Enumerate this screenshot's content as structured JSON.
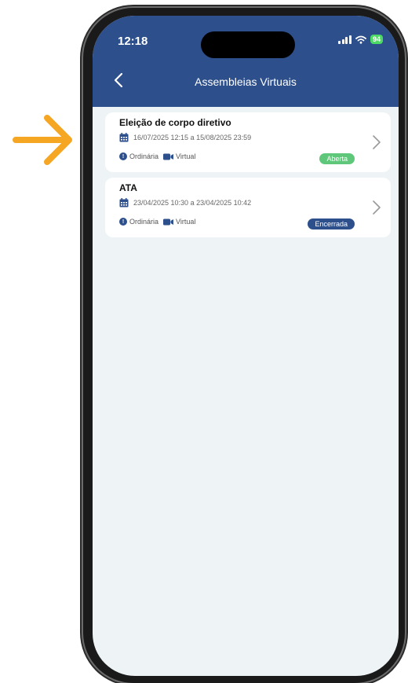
{
  "status_bar": {
    "time": "12:18",
    "battery": "94"
  },
  "header": {
    "title": "Assembleias Virtuais"
  },
  "assemblies": [
    {
      "title": "Eleição de corpo diretivo",
      "date_range": "16/07/2025 12:15 a 15/08/2025 23:59",
      "type": "Ordinária",
      "mode": "Virtual",
      "status": "Aberta",
      "status_color": "#5fc77a"
    },
    {
      "title": "ATA",
      "date_range": "23/04/2025 10:30 a 23/04/2025 10:42",
      "type": "Ordinária",
      "mode": "Virtual",
      "status": "Encerrada",
      "status_color": "#2d4f8b"
    }
  ],
  "colors": {
    "header": "#2d4f8b",
    "accent_arrow": "#f5a623",
    "background": "#eef3f5"
  },
  "icons": [
    "arrow-right-icon",
    "back-icon",
    "calendar-icon",
    "info-icon",
    "video-icon",
    "chevron-right-icon",
    "signal-icon",
    "wifi-icon"
  ]
}
